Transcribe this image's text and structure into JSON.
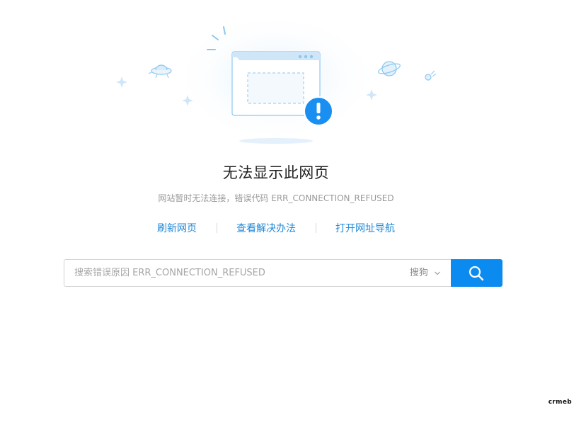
{
  "error": {
    "title": "无法显示此网页",
    "subtitle": "网站暂时无法连接，错误代码 ERR_CONNECTION_REFUSED"
  },
  "actions": [
    {
      "label": "刷新网页"
    },
    {
      "label": "查看解决办法"
    },
    {
      "label": "打开网址导航"
    }
  ],
  "search": {
    "placeholder": "搜索错误原因 ERR_CONNECTION_REFUSED",
    "engine": "搜狗",
    "button_icon": "search-icon"
  },
  "watermark": "crmeb",
  "colors": {
    "accent": "#0b8af0",
    "link": "#1f88d6",
    "alert": "#1a8ff2"
  }
}
